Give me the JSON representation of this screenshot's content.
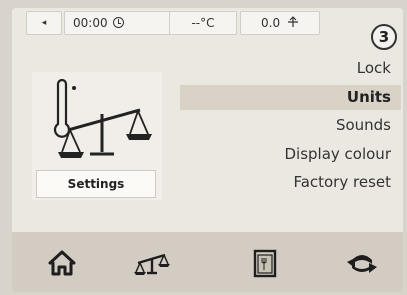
{
  "status_bar": {
    "back_glyph": "◂",
    "time": "00:00",
    "temperature": "--°C",
    "weight": "0.0"
  },
  "page_badge": "3",
  "settings_tile": {
    "label": "Settings",
    "icon": "thermometer-scale-icon"
  },
  "menu": {
    "items": [
      {
        "label": "Lock",
        "selected": false
      },
      {
        "label": "Units",
        "selected": true
      },
      {
        "label": "Sounds",
        "selected": false
      },
      {
        "label": "Display colour",
        "selected": false
      },
      {
        "label": "Factory reset",
        "selected": false
      }
    ]
  },
  "nav": {
    "buttons": [
      {
        "icon": "home-icon"
      },
      {
        "icon": "scale-icon"
      },
      {
        "icon": "recipe-book-icon"
      },
      {
        "icon": "return-icon"
      }
    ]
  },
  "colors": {
    "selected_row": "#d9d2c6",
    "nav_background": "#d2ccc3",
    "screen_background": "#ebe8e2"
  }
}
